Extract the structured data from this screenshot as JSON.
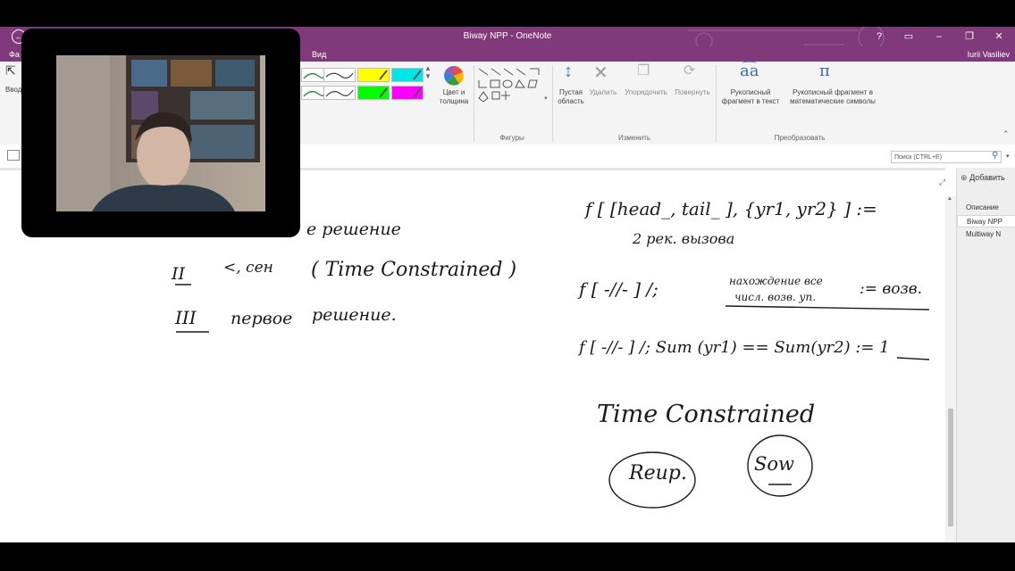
{
  "window": {
    "title": "Biway NPP - OneNote",
    "help": "?",
    "user": "Iurii Vasiliev"
  },
  "menu": {
    "file_partial": "Фа",
    "view": "Вид"
  },
  "ribbon": {
    "insert_partial": "Ввод",
    "color_width": "Цвет и толщина",
    "shapes_group": "Фигуры",
    "empty_area": "Пустая область",
    "delete": "Удалить",
    "arrange": "Упорядочить",
    "rotate": "Повернуть",
    "edit_group": "Изменить",
    "ink_to_text": "Рукописный фрагмент в текст",
    "ink_to_math": "Рукописный фрагмент в математические символы",
    "convert_group": "Преобразовать",
    "highlighter_colors": [
      "#ffff00",
      "#00e6e6",
      "#00ff00",
      "#ff00ff"
    ]
  },
  "search": {
    "placeholder": "Поиск (CTRL+E)"
  },
  "pages": {
    "add_label": "Добавить",
    "items": [
      "Описание",
      "Biway NPP",
      "Multiway N"
    ],
    "selected": "Biway NPP"
  },
  "ink": {
    "left": {
      "line1": "е решение",
      "line2_num": "II",
      "line2_a": "<, сен",
      "line2_b": "( Time Constrained )",
      "line3_num": "III",
      "line3_a": "первое",
      "line3_b": "решение."
    },
    "right": {
      "eq1": "f [ [head_, tail_ ], {yr1, yr2} ] :=",
      "eq1b": "2 рек. вызова",
      "eq2a": "f [ -//- ] /;",
      "eq2b": "нахождение все",
      "eq2c": "числ. возв. уп.",
      "eq2d": ":= возв.",
      "eq3": "f [ -//- ] /; Sum (yr1) == Sum(yr2) := 1",
      "tc": "Time Constrained",
      "left_circle": "Reup.",
      "right_circle": "Sow"
    }
  }
}
